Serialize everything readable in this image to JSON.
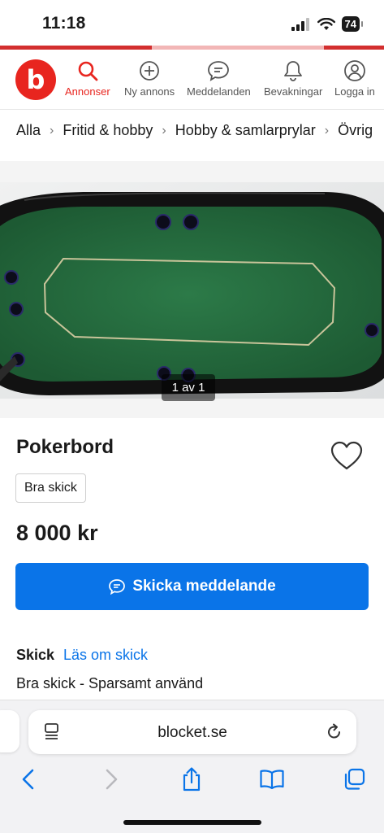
{
  "status": {
    "time": "11:18",
    "battery": "74"
  },
  "header": {
    "logo_letter": "b",
    "nav": [
      {
        "label": "Annonser",
        "icon": "search-icon",
        "active": true
      },
      {
        "label": "Ny annons",
        "icon": "plus-circle-icon"
      },
      {
        "label": "Meddelanden",
        "icon": "chat-icon"
      },
      {
        "label": "Bevakningar",
        "icon": "bell-icon"
      },
      {
        "label": "Logga in",
        "icon": "user-icon"
      }
    ],
    "accent": "#e8251f"
  },
  "breadcrumb": [
    "Alla",
    "Fritid & hobby",
    "Hobby & samlarprylar",
    "Övrig"
  ],
  "gallery": {
    "counter": "1 av 1"
  },
  "listing": {
    "title": "Pokerbord",
    "condition_badge": "Bra skick",
    "price": "8 000 kr",
    "cta_label": "Skicka meddelande",
    "cta_color": "#0a74e8",
    "condition_heading": "Skick",
    "condition_link": "Läs om skick",
    "condition_text": "Bra skick - Sparsamt använd"
  },
  "browser": {
    "url": "blocket.se"
  }
}
